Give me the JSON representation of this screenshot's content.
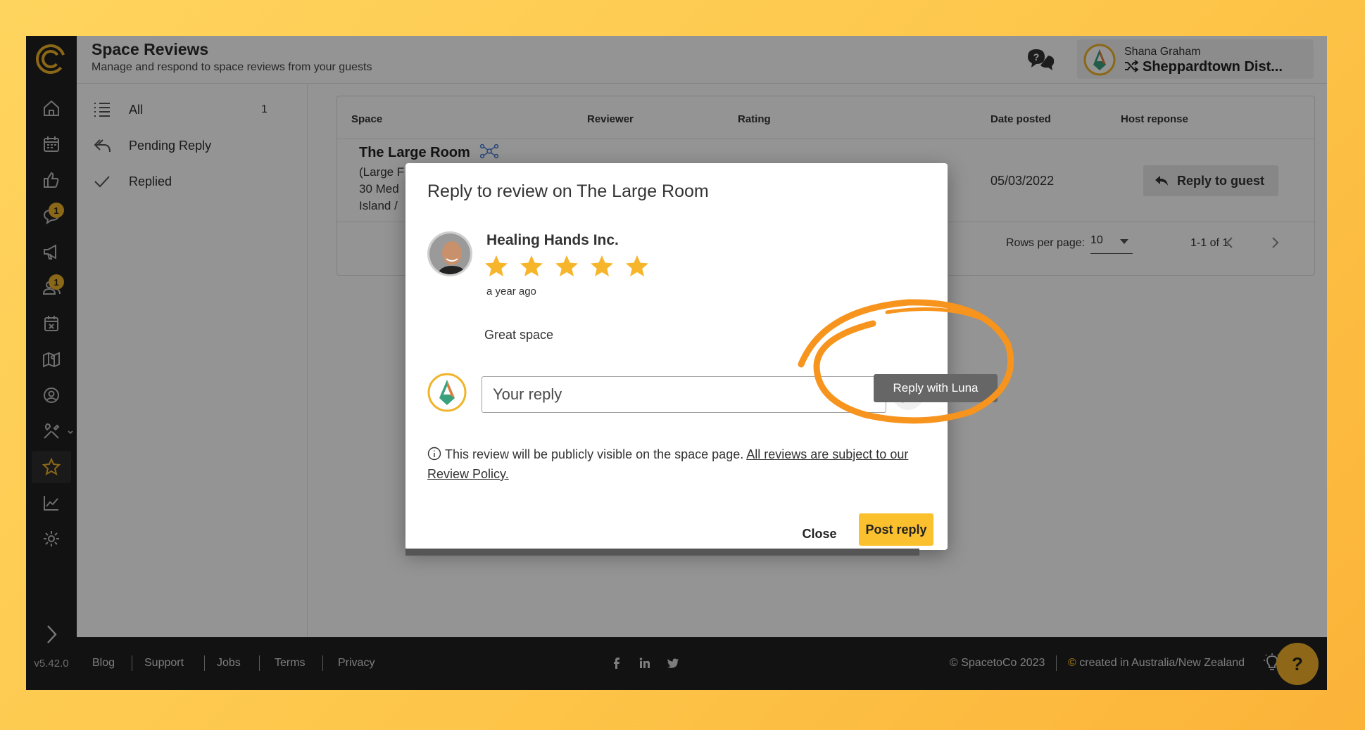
{
  "header": {
    "title": "Space Reviews",
    "subtitle": "Manage and respond to space reviews from your guests",
    "user_name": "Shana Graham",
    "org_name": "Sheppardtown Dist..."
  },
  "rail": {
    "version": "v5.42.0",
    "badges": {
      "messages": "1",
      "contacts": "1"
    },
    "items": [
      "home-icon",
      "calendar-icon",
      "thumbs-up-icon",
      "chat-icon",
      "megaphone-icon",
      "contacts-icon",
      "cancel-calendar-icon",
      "map-icon",
      "user-circle-icon",
      "tools-icon",
      "star-icon",
      "chart-icon",
      "gear-icon"
    ]
  },
  "sidemenu": {
    "items": [
      {
        "label": "All",
        "count": "1"
      },
      {
        "label": "Pending Reply"
      },
      {
        "label": "Replied"
      }
    ]
  },
  "table": {
    "columns": [
      "Space",
      "Reviewer",
      "Rating",
      "Date posted",
      "Host reponse"
    ],
    "row": {
      "space_name": "The Large Room",
      "space_meta_1": "(Large F",
      "space_meta_2": "30 Med",
      "space_meta_3": "Island /",
      "date": "05/03/2022",
      "action": "Reply to guest"
    },
    "rows_per_page_label": "Rows per page:",
    "rows_per_page_value": "10",
    "range": "1-1 of 1"
  },
  "footer": {
    "links": [
      "Blog",
      "Support",
      "Jobs",
      "Terms",
      "Privacy"
    ],
    "copyright": "© SpacetoCo 2023",
    "created": "created in Australia/New Zealand",
    "help": "?"
  },
  "dialog": {
    "title": "Reply to review on The Large Room",
    "reviewer_name": "Healing Hands Inc.",
    "rating": 5,
    "time_ago": "a year ago",
    "comment": "Great space",
    "reply_placeholder": "Your reply",
    "tooltip": "Reply with Luna",
    "notice_text": "This review will be publicly visible on the space page.",
    "notice_link": "All reviews are subject to our Review Policy.",
    "close_label": "Close",
    "post_label": "Post reply"
  },
  "colors": {
    "accent": "#fbc02d",
    "rail_bg": "#1f1f1f",
    "annotation": "#f7941d",
    "star": "#f7b52c"
  }
}
